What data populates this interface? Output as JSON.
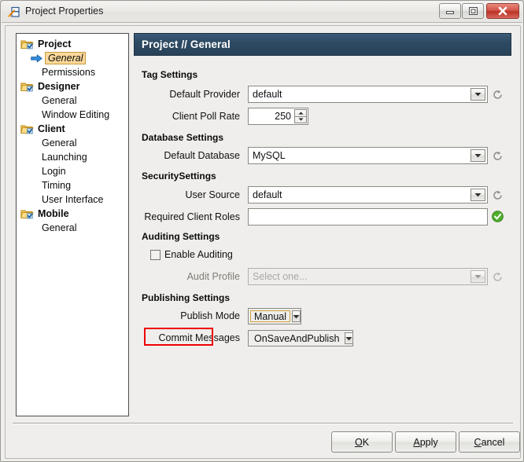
{
  "window": {
    "title": "Project Properties",
    "icon": "project-properties-icon",
    "controls": {
      "minimize": "minimize-button",
      "maximize": "maximize-button",
      "close": "close-button"
    }
  },
  "sidebar": {
    "items": [
      {
        "label": "Project",
        "type": "group",
        "icon": "folder-check-icon"
      },
      {
        "label": "General",
        "type": "leaf",
        "selected": true,
        "icon": "blue-arrow-icon"
      },
      {
        "label": "Permissions",
        "type": "leaf",
        "selected": false
      },
      {
        "label": "Designer",
        "type": "group",
        "icon": "folder-check-icon"
      },
      {
        "label": "General",
        "type": "leaf",
        "selected": false
      },
      {
        "label": "Window Editing",
        "type": "leaf",
        "selected": false
      },
      {
        "label": "Client",
        "type": "group",
        "icon": "folder-check-icon"
      },
      {
        "label": "General",
        "type": "leaf",
        "selected": false
      },
      {
        "label": "Launching",
        "type": "leaf",
        "selected": false
      },
      {
        "label": "Login",
        "type": "leaf",
        "selected": false
      },
      {
        "label": "Timing",
        "type": "leaf",
        "selected": false
      },
      {
        "label": "User Interface",
        "type": "leaf",
        "selected": false
      },
      {
        "label": "Mobile",
        "type": "group",
        "icon": "folder-check-icon"
      },
      {
        "label": "General",
        "type": "leaf",
        "selected": false
      }
    ]
  },
  "main": {
    "header": "Project // General",
    "sections": {
      "tag": {
        "title": "Tag Settings",
        "default_provider": {
          "label": "Default Provider",
          "value": "default"
        },
        "client_poll_rate": {
          "label": "Client Poll Rate",
          "value": "250"
        }
      },
      "database": {
        "title": "Database Settings",
        "default_database": {
          "label": "Default Database",
          "value": "MySQL"
        }
      },
      "security": {
        "title": "SecuritySettings",
        "user_source": {
          "label": "User Source",
          "value": "default"
        },
        "required_client_roles": {
          "label": "Required Client Roles",
          "value": "",
          "status": "valid"
        }
      },
      "auditing": {
        "title": "Auditing Settings",
        "enable_auditing": {
          "label": "Enable Auditing",
          "checked": false
        },
        "audit_profile": {
          "label": "Audit Profile",
          "value": "Select one...",
          "disabled": true
        }
      },
      "publishing": {
        "title": "Publishing Settings",
        "publish_mode": {
          "label": "Publish Mode",
          "value": "Manual",
          "focused": true,
          "annotated": true
        },
        "commit_messages": {
          "label": "Commit Messages",
          "value": "OnSaveAndPublish"
        }
      }
    }
  },
  "footer": {
    "ok": {
      "mnemonic": "O",
      "rest": "K"
    },
    "apply": {
      "mnemonic": "A",
      "rest": "pply"
    },
    "cancel": {
      "mnemonic": "C",
      "rest": "ancel"
    }
  },
  "colors": {
    "header_bg": "#2e4a63",
    "annotation": "#ee0000",
    "selection": "#fcd99a",
    "valid": "#3fa52b",
    "close_button": "#bb3226"
  }
}
